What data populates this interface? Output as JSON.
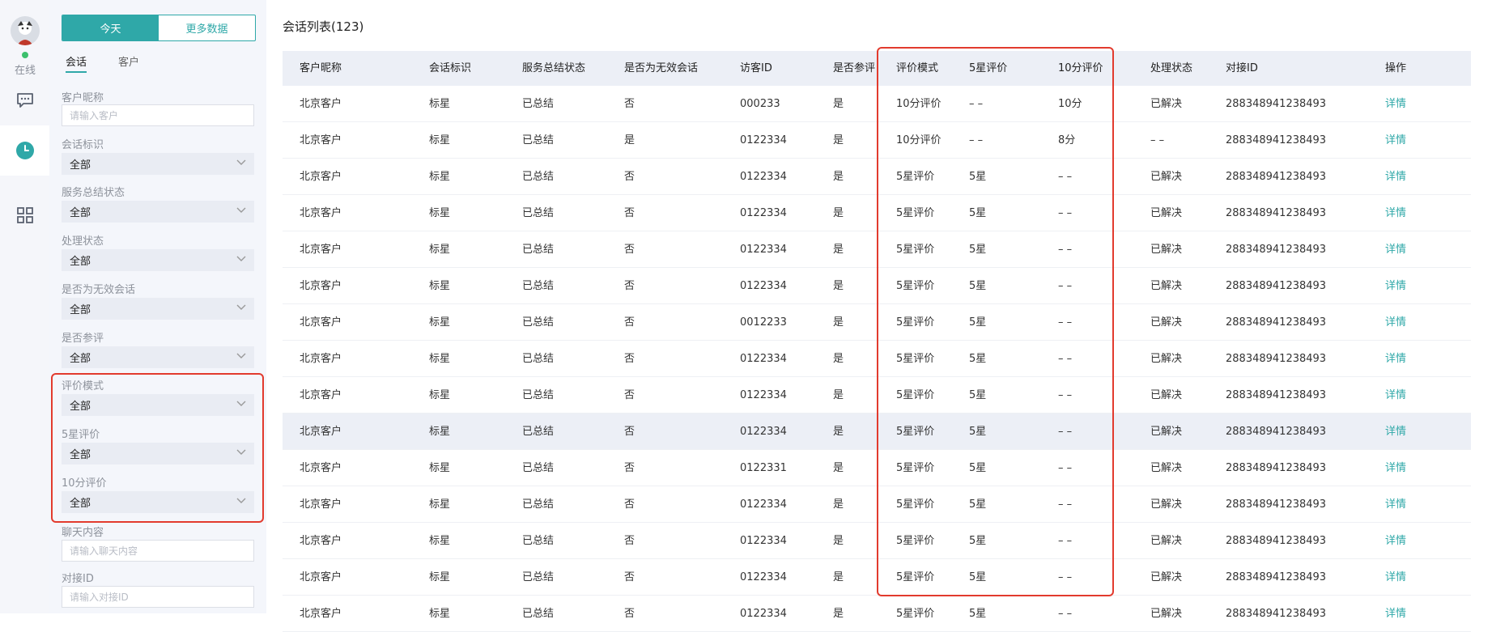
{
  "rail": {
    "status_label": "在线"
  },
  "panel": {
    "segment": {
      "today": "今天",
      "more": "更多数据"
    },
    "tabs": {
      "session": "会话",
      "customer": "客户"
    },
    "filters": {
      "customer_nickname": {
        "label": "客户昵称",
        "placeholder": "请输入客户"
      },
      "session_tag": {
        "label": "会话标识",
        "value": "全部"
      },
      "service_summary": {
        "label": "服务总结状态",
        "value": "全部"
      },
      "process_status": {
        "label": "处理状态",
        "value": "全部"
      },
      "invalid_session": {
        "label": "是否为无效会话",
        "value": "全部"
      },
      "participate_review": {
        "label": "是否参评",
        "value": "全部"
      },
      "review_mode": {
        "label": "评价模式",
        "value": "全部"
      },
      "five_star": {
        "label": "5星评价",
        "value": "全部"
      },
      "ten_point": {
        "label": "10分评价",
        "value": "全部"
      },
      "chat_content": {
        "label": "聊天内容",
        "placeholder": "请输入聊天内容"
      },
      "dock_id": {
        "label": "对接ID",
        "placeholder": "请输入对接ID"
      }
    }
  },
  "main": {
    "title": "会话列表(123)",
    "columns": [
      "客户昵称",
      "会话标识",
      "服务总结状态",
      "是否为无效会话",
      "访客ID",
      "是否参评",
      "评价模式",
      "5星评价",
      "10分评价",
      "处理状态",
      "对接ID",
      "操作"
    ],
    "rows": [
      [
        "北京客户",
        "标星",
        "已总结",
        "否",
        "000233",
        "是",
        "10分评价",
        "– –",
        "10分",
        "已解决",
        "288348941238493",
        "详情"
      ],
      [
        "北京客户",
        "标星",
        "已总结",
        "是",
        "0122334",
        "是",
        "10分评价",
        "– –",
        "8分",
        "– –",
        "288348941238493",
        "详情"
      ],
      [
        "北京客户",
        "标星",
        "已总结",
        "否",
        "0122334",
        "是",
        "5星评价",
        "5星",
        "– –",
        "已解决",
        "288348941238493",
        "详情"
      ],
      [
        "北京客户",
        "标星",
        "已总结",
        "否",
        "0122334",
        "是",
        "5星评价",
        "5星",
        "– –",
        "已解决",
        "288348941238493",
        "详情"
      ],
      [
        "北京客户",
        "标星",
        "已总结",
        "否",
        "0122334",
        "是",
        "5星评价",
        "5星",
        "– –",
        "已解决",
        "288348941238493",
        "详情"
      ],
      [
        "北京客户",
        "标星",
        "已总结",
        "否",
        "0122334",
        "是",
        "5星评价",
        "5星",
        "– –",
        "已解决",
        "288348941238493",
        "详情"
      ],
      [
        "北京客户",
        "标星",
        "已总结",
        "否",
        "0012233",
        "是",
        "5星评价",
        "5星",
        "– –",
        "已解决",
        "288348941238493",
        "详情"
      ],
      [
        "北京客户",
        "标星",
        "已总结",
        "否",
        "0122334",
        "是",
        "5星评价",
        "5星",
        "– –",
        "已解决",
        "288348941238493",
        "详情"
      ],
      [
        "北京客户",
        "标星",
        "已总结",
        "否",
        "0122334",
        "是",
        "5星评价",
        "5星",
        "– –",
        "已解决",
        "288348941238493",
        "详情"
      ],
      [
        "北京客户",
        "标星",
        "已总结",
        "否",
        "0122334",
        "是",
        "5星评价",
        "5星",
        "– –",
        "已解决",
        "288348941238493",
        "详情"
      ],
      [
        "北京客户",
        "标星",
        "已总结",
        "否",
        "0122331",
        "是",
        "5星评价",
        "5星",
        "– –",
        "已解决",
        "288348941238493",
        "详情"
      ],
      [
        "北京客户",
        "标星",
        "已总结",
        "否",
        "0122334",
        "是",
        "5星评价",
        "5星",
        "– –",
        "已解决",
        "288348941238493",
        "详情"
      ],
      [
        "北京客户",
        "标星",
        "已总结",
        "否",
        "0122334",
        "是",
        "5星评价",
        "5星",
        "– –",
        "已解决",
        "288348941238493",
        "详情"
      ],
      [
        "北京客户",
        "标星",
        "已总结",
        "否",
        "0122334",
        "是",
        "5星评价",
        "5星",
        "– –",
        "已解决",
        "288348941238493",
        "详情"
      ],
      [
        "北京客户",
        "标星",
        "已总结",
        "否",
        "0122334",
        "是",
        "5星评价",
        "5星",
        "– –",
        "已解决",
        "288348941238493",
        "详情"
      ]
    ]
  },
  "colors": {
    "accent": "#2fa8a8",
    "highlight_box": "#e23b2e",
    "online": "#3cc06d"
  },
  "icons": [
    "avatar",
    "chat-bubble-icon",
    "clock-icon",
    "grid-icon",
    "chevron-down-icon"
  ]
}
